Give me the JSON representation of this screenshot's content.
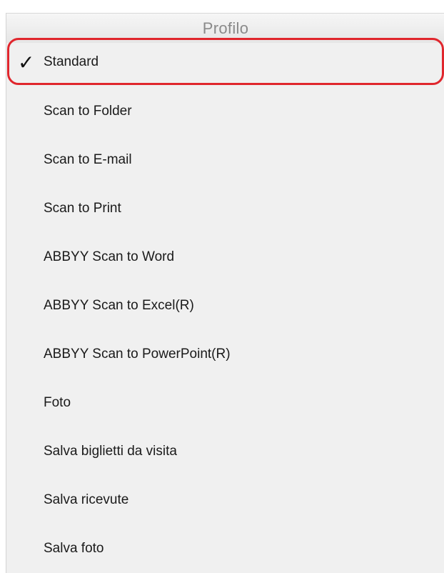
{
  "header": {
    "title": "Profilo"
  },
  "menu": {
    "selected_mark": "✓",
    "items": [
      {
        "label": "Standard",
        "selected": true
      },
      {
        "label": "Scan to Folder",
        "selected": false
      },
      {
        "label": "Scan to E-mail",
        "selected": false
      },
      {
        "label": "Scan to Print",
        "selected": false
      },
      {
        "label": "ABBYY Scan to Word",
        "selected": false
      },
      {
        "label": "ABBYY Scan to Excel(R)",
        "selected": false
      },
      {
        "label": "ABBYY Scan to PowerPoint(R)",
        "selected": false
      },
      {
        "label": "Foto",
        "selected": false
      },
      {
        "label": "Salva biglietti da visita",
        "selected": false
      },
      {
        "label": "Salva ricevute",
        "selected": false
      },
      {
        "label": "Salva foto",
        "selected": false
      }
    ]
  },
  "colors": {
    "background": "#f0f0f0",
    "highlight_border": "#e0262d",
    "header_text": "#8a8a8a"
  }
}
